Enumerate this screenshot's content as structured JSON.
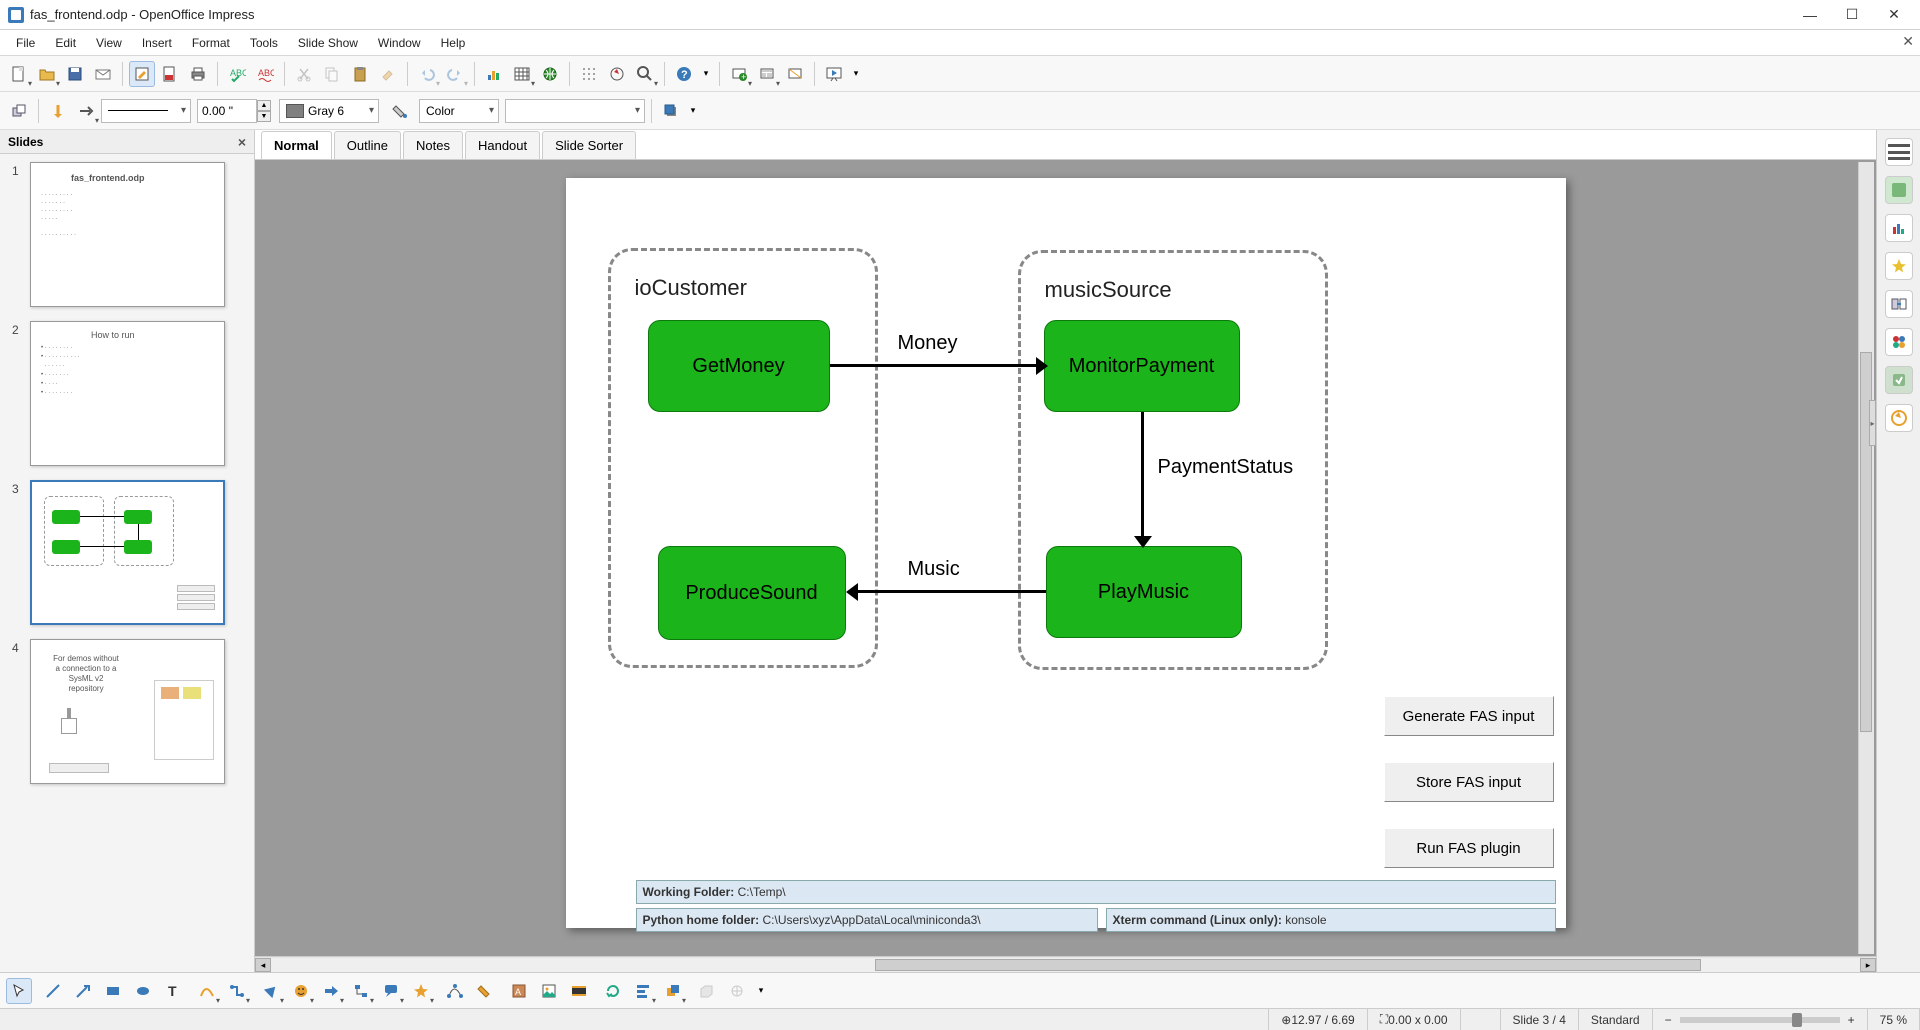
{
  "window": {
    "title": "fas_frontend.odp - OpenOffice Impress"
  },
  "menu": {
    "items": [
      "File",
      "Edit",
      "View",
      "Insert",
      "Format",
      "Tools",
      "Slide Show",
      "Window",
      "Help"
    ]
  },
  "toolbar2": {
    "linewidth": "0.00 \"",
    "linecolor_label": "Gray 6",
    "fillmode": "Color"
  },
  "slidespanel": {
    "title": "Slides",
    "thumbs": [
      {
        "num": "1",
        "title": "fas_frontend.odp"
      },
      {
        "num": "2",
        "title": "How to run"
      },
      {
        "num": "3",
        "title": ""
      },
      {
        "num": "4",
        "title": "For demos without a connection to a SysML v2 repository"
      }
    ],
    "selected_index": 2
  },
  "viewtabs": {
    "tabs": [
      "Normal",
      "Outline",
      "Notes",
      "Handout",
      "Slide Sorter"
    ],
    "active": "Normal"
  },
  "diagram": {
    "groups": [
      {
        "id": "ioCustomer",
        "label": "ioCustomer"
      },
      {
        "id": "musicSource",
        "label": "musicSource"
      }
    ],
    "nodes": [
      {
        "id": "GetMoney",
        "label": "GetMoney",
        "group": "ioCustomer"
      },
      {
        "id": "ProduceSound",
        "label": "ProduceSound",
        "group": "ioCustomer"
      },
      {
        "id": "MonitorPayment",
        "label": "MonitorPayment",
        "group": "musicSource"
      },
      {
        "id": "PlayMusic",
        "label": "PlayMusic",
        "group": "musicSource"
      }
    ],
    "edges": [
      {
        "from": "GetMoney",
        "to": "MonitorPayment",
        "label": "Money"
      },
      {
        "from": "MonitorPayment",
        "to": "PlayMusic",
        "label": "PaymentStatus"
      },
      {
        "from": "PlayMusic",
        "to": "ProduceSound",
        "label": "Music"
      }
    ],
    "buttons": {
      "generate": "Generate FAS input",
      "store": "Store FAS input",
      "run": "Run FAS plugin"
    },
    "info": {
      "working_folder_label": "Working Folder:",
      "working_folder_value": " C:\\Temp\\",
      "python_home_label": "Python home folder:",
      "python_home_value": " C:\\Users\\xyz\\AppData\\Local\\miniconda3\\",
      "xterm_label": "Xterm command (Linux only):",
      "xterm_value": " konsole"
    }
  },
  "status": {
    "coords": "12.97 / 6.69",
    "size": "0.00 x 0.00",
    "slide": "Slide 3 / 4",
    "mode": "Standard",
    "zoom": "75 %"
  }
}
